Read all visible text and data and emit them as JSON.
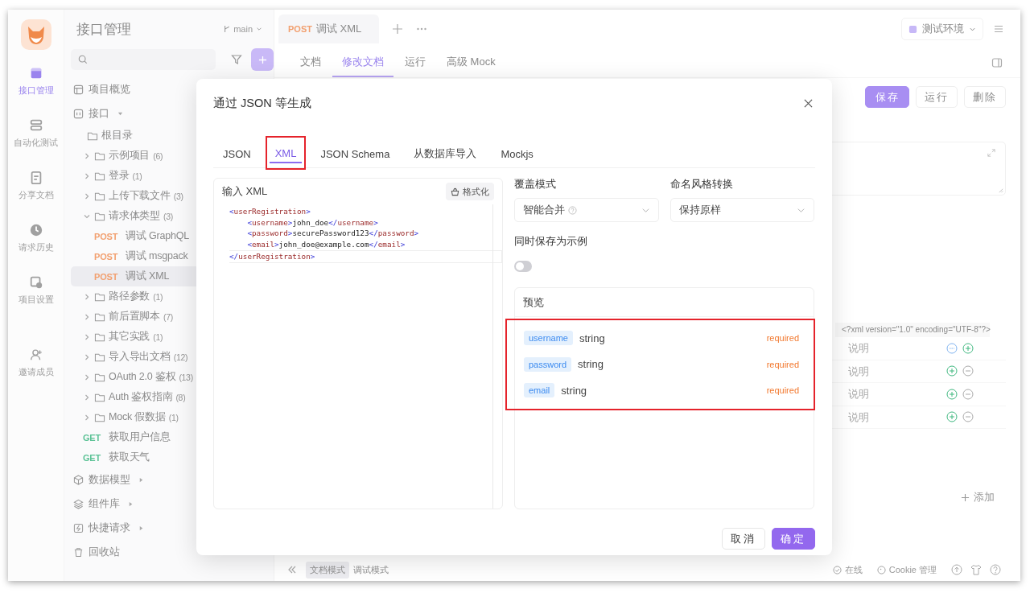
{
  "rail": {
    "items": [
      {
        "label": "接口管理",
        "selected": true
      },
      {
        "label": "自动化测试",
        "selected": false
      },
      {
        "label": "分享文档",
        "selected": false
      },
      {
        "label": "请求历史",
        "selected": false
      },
      {
        "label": "项目设置",
        "selected": false
      },
      {
        "label": "邀请成员",
        "selected": false
      }
    ]
  },
  "sidebar": {
    "title": "接口管理",
    "branch": "main",
    "nav_top": [
      {
        "label": "项目概览"
      },
      {
        "label": "接口",
        "expanded": true
      }
    ],
    "tree": {
      "kind": "folder",
      "label": "根目录",
      "children": [
        {
          "kind": "folder",
          "label": "示例项目",
          "count": "(6)",
          "expanded": false
        },
        {
          "kind": "folder",
          "label": "登录",
          "count": "(1)",
          "expanded": false
        },
        {
          "kind": "folder",
          "label": "上传下载文件",
          "count": "(3)",
          "expanded": false
        },
        {
          "kind": "folder",
          "label": "请求体类型",
          "count": "(3)",
          "expanded": true,
          "children": [
            {
              "kind": "request",
              "method": "POST",
              "color": "#f2a070",
              "label": "调试 GraphQL",
              "selected": false
            },
            {
              "kind": "request",
              "method": "POST",
              "color": "#f2a070",
              "label": "调试 msgpack",
              "selected": false
            },
            {
              "kind": "request",
              "method": "POST",
              "color": "#f2a070",
              "label": "调试 XML",
              "selected": true
            }
          ]
        },
        {
          "kind": "folder",
          "label": "路径参数",
          "count": "(1)",
          "expanded": false
        },
        {
          "kind": "folder",
          "label": "前后置脚本",
          "count": "(7)",
          "expanded": false
        },
        {
          "kind": "folder",
          "label": "其它实践",
          "count": "(1)",
          "expanded": false
        },
        {
          "kind": "folder",
          "label": "导入导出文档",
          "count": "(12)",
          "expanded": false
        },
        {
          "kind": "folder",
          "label": "OAuth 2.0 鉴权",
          "count": "(13)",
          "expanded": false
        },
        {
          "kind": "folder",
          "label": "Auth 鉴权指南",
          "count": "(8)",
          "expanded": false
        },
        {
          "kind": "folder",
          "label": "Mock 假数据",
          "count": "(1)",
          "expanded": false
        },
        {
          "kind": "request",
          "method": "GET",
          "color": "#5cc296",
          "label": "获取用户信息",
          "selected": false
        },
        {
          "kind": "request",
          "method": "GET",
          "color": "#5cc296",
          "label": "获取天气",
          "selected": false
        }
      ]
    },
    "nav_bottom": [
      {
        "label": "数据模型",
        "expanded": false
      },
      {
        "label": "组件库",
        "expanded": false
      },
      {
        "label": "快捷请求",
        "expanded": false
      },
      {
        "label": "回收站"
      }
    ]
  },
  "main": {
    "tabs": [
      {
        "method": "POST",
        "color": "#f2a070",
        "label": "调试 XML"
      }
    ],
    "env": "测试环境",
    "subtabs": [
      {
        "label": "文档",
        "selected": false
      },
      {
        "label": "修改文档",
        "selected": true
      },
      {
        "label": "运行",
        "selected": false
      },
      {
        "label": "高级 Mock",
        "selected": false
      }
    ],
    "actions": [
      {
        "label": "保存",
        "kind": "primary"
      },
      {
        "label": "运行",
        "kind": "default"
      },
      {
        "label": "删除",
        "kind": "default"
      }
    ],
    "xml_declaration": "<?xml version=\"1.0\" encoding=\"UTF-8\"?>",
    "rows": [
      {
        "placeholder": "说明",
        "kind": "root"
      },
      {
        "placeholder": "说明",
        "kind": "item"
      },
      {
        "placeholder": "说明",
        "kind": "item"
      },
      {
        "placeholder": "说明",
        "kind": "item"
      }
    ],
    "add_label": "添加",
    "modes": [
      {
        "label": "文档模式",
        "selected": true
      },
      {
        "label": "调试模式",
        "selected": false
      }
    ],
    "status": "在线",
    "cookie": "Cookie 管理"
  },
  "modal": {
    "title": "通过 JSON 等生成",
    "tabs": [
      {
        "label": "JSON",
        "selected": false,
        "highlighted": false
      },
      {
        "label": "XML",
        "selected": true,
        "highlighted": true
      },
      {
        "label": "JSON Schema",
        "selected": false,
        "highlighted": false
      },
      {
        "label": "从数据库导入",
        "selected": false,
        "highlighted": false
      },
      {
        "label": "Mockjs",
        "selected": false,
        "highlighted": false
      }
    ],
    "editor": {
      "label": "输入 XML",
      "format_button": "格式化",
      "lines": [
        "<userRegistration>",
        "    <username>john_doe</username>",
        "    <password>securePassword123</password>",
        "    <email>john_doe@example.com</email>",
        "</userRegistration>"
      ]
    },
    "fields": [
      {
        "label": "覆盖模式",
        "value": "智能合并",
        "help": true
      },
      {
        "label": "命名风格转换",
        "value": "保持原样",
        "help": false
      }
    ],
    "save_example": {
      "label": "同时保存为示例",
      "on": false
    },
    "preview": {
      "title": "预览",
      "highlighted": true,
      "rows": [
        {
          "name": "username",
          "type": "string",
          "required": "required"
        },
        {
          "name": "password",
          "type": "string",
          "required": "required"
        },
        {
          "name": "email",
          "type": "string",
          "required": "required"
        }
      ]
    },
    "buttons": [
      {
        "label": "取消",
        "kind": "default"
      },
      {
        "label": "确定",
        "kind": "primary"
      }
    ]
  }
}
